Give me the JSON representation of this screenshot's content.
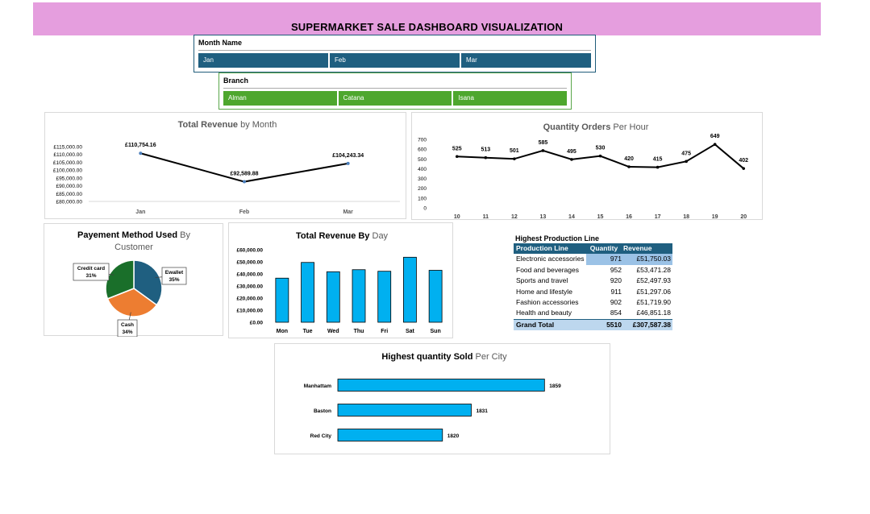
{
  "title": "SUPERMARKET SALE DASHBOARD VISUALIZATION",
  "colors": {
    "header_bg": "#e59ede",
    "slicer_month": "#1f5f80",
    "slicer_branch": "#4ea72e",
    "bar": "#00b0f0",
    "table_header": "#1f5f80"
  },
  "slicers": {
    "month": {
      "label": "Month Name",
      "items": [
        "Jan",
        "Feb",
        "Mar"
      ]
    },
    "branch": {
      "label": "Branch",
      "items": [
        "Alman",
        "Catana",
        "Isana"
      ]
    }
  },
  "chart_data": [
    {
      "type": "line",
      "title_bold": "Total Revenue",
      "title_rest": " by Month",
      "categories": [
        "Jan",
        "Feb",
        "Mar"
      ],
      "values": [
        110754.16,
        92589.88,
        104243.34
      ],
      "data_labels": [
        "£110,754.16",
        "£92,589.88",
        "£104,243.34"
      ],
      "ylim": [
        80000,
        115000
      ],
      "yticks": [
        "£115,000.00",
        "£110,000.00",
        "£105,000.00",
        "£100,000.00",
        "£95,000.00",
        "£90,000.00",
        "£85,000.00",
        "£80,000.00"
      ]
    },
    {
      "type": "line",
      "title_bold": "Quantity Orders",
      "title_rest": " Per Hour",
      "categories": [
        "10",
        "11",
        "12",
        "13",
        "14",
        "15",
        "16",
        "17",
        "18",
        "19",
        "20"
      ],
      "values": [
        525,
        513,
        501,
        585,
        495,
        530,
        420,
        415,
        475,
        649,
        402
      ],
      "ylim": [
        0,
        700
      ],
      "yticks": [
        "700",
        "600",
        "500",
        "400",
        "300",
        "200",
        "100",
        "0"
      ]
    },
    {
      "type": "pie",
      "title_bold": "Payement Method Used",
      "title_rest": " By",
      "title_line2": "Customer",
      "slices": [
        {
          "name": "Ewallet",
          "value": 35,
          "label": "35%",
          "color": "#1f5f80"
        },
        {
          "name": "Cash",
          "value": 34,
          "label": "34%",
          "color": "#ed7d31"
        },
        {
          "name": "Credit card",
          "value": 31,
          "label": "31%",
          "color": "#1a6f2a"
        }
      ]
    },
    {
      "type": "bar",
      "title_bold": "Total Revenue By",
      "title_rest": " Day",
      "categories": [
        "Mon",
        "Tue",
        "Wed",
        "Thu",
        "Fri",
        "Sat",
        "Sun"
      ],
      "values": [
        36500,
        49500,
        41800,
        43500,
        42200,
        53800,
        43000
      ],
      "ylim": [
        0,
        60000
      ],
      "yticks": [
        "£60,000.00",
        "£50,000.00",
        "£40,000.00",
        "£30,000.00",
        "£20,000.00",
        "£10,000.00",
        "£0.00"
      ]
    },
    {
      "type": "table",
      "title": "Highest Production Line",
      "columns": [
        "Production Line",
        "Quantity",
        "Revenue"
      ],
      "rows": [
        [
          "Electronic accessories",
          "971",
          "£51,750.03"
        ],
        [
          "Food and beverages",
          "952",
          "£53,471.28"
        ],
        [
          "Sports and travel",
          "920",
          "£52,497.93"
        ],
        [
          "Home and lifestyle",
          "911",
          "£51,297.06"
        ],
        [
          "Fashion accessories",
          "902",
          "£51,719.90"
        ],
        [
          "Health and beauty",
          "854",
          "£46,851.18"
        ]
      ],
      "total": [
        "Grand Total",
        "5510",
        "£307,587.38"
      ]
    },
    {
      "type": "bar",
      "orientation": "horizontal",
      "title_bold": "Highest quantity Sold",
      "title_rest": " Per City",
      "categories": [
        "Manhattam",
        "Baston",
        "Red City"
      ],
      "values": [
        1859,
        1831,
        1820
      ],
      "xlim": [
        1780,
        1870
      ]
    }
  ]
}
